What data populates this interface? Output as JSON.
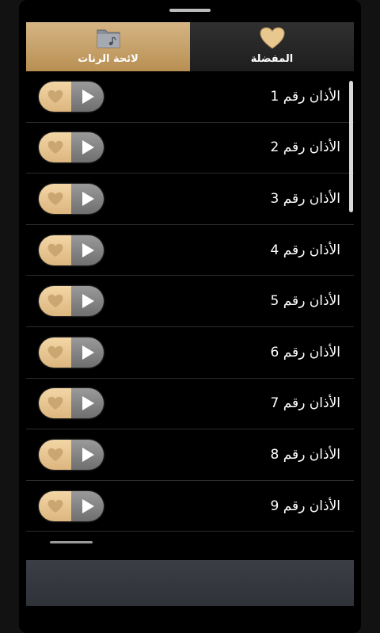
{
  "tabs": {
    "ringtones_label": "لائحة الرنات",
    "favorites_label": "المفضلة",
    "active": "ringtones"
  },
  "list": {
    "items": [
      {
        "title": "الأذان رقم 1"
      },
      {
        "title": "الأذان رقم 2"
      },
      {
        "title": "الأذان رقم 3"
      },
      {
        "title": "الأذان رقم 4"
      },
      {
        "title": "الأذان رقم 5"
      },
      {
        "title": "الأذان رقم 6"
      },
      {
        "title": "الأذان رقم 7"
      },
      {
        "title": "الأذان رقم 8"
      },
      {
        "title": "الأذان رقم 9"
      }
    ]
  },
  "icons": {
    "tab_ringtones": "folder-music-icon",
    "tab_favorites": "heart-icon",
    "row_favorite": "heart-icon",
    "row_play": "play-icon"
  },
  "colors": {
    "accent_gold": "#c9a46c",
    "play_gray": "#8a8a8a",
    "background": "#000000"
  }
}
